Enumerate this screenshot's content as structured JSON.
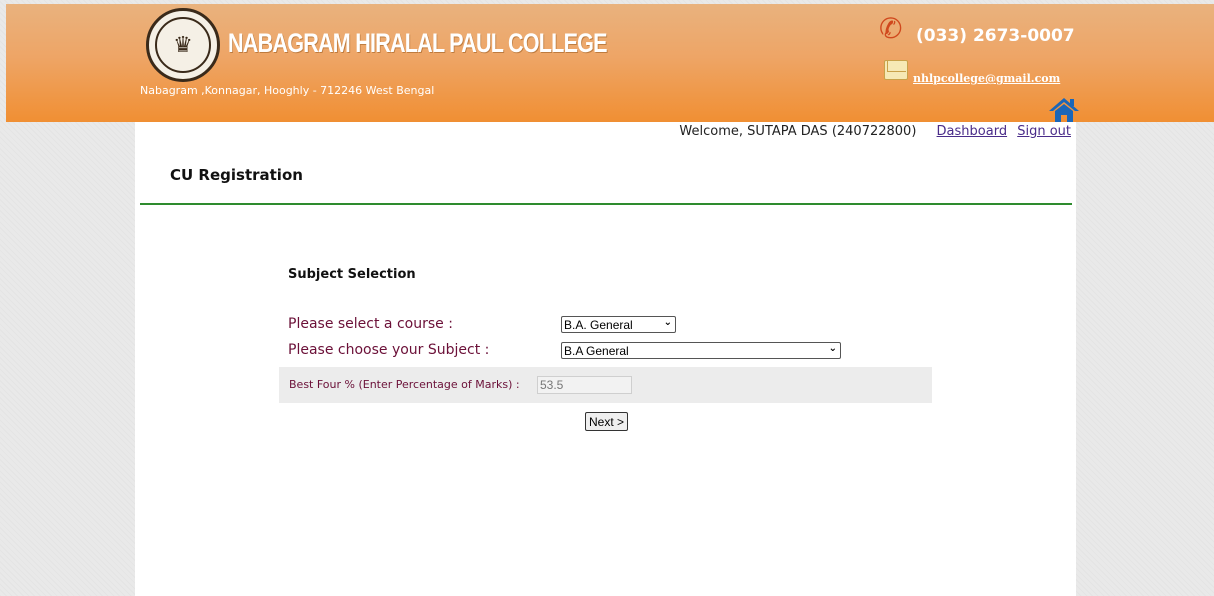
{
  "header": {
    "college_name": "NABAGRAM HIRALAL PAUL COLLEGE",
    "address": "Nabagram ,Konnagar, Hooghly - 712246 West Bengal",
    "phone": "(033) 2673-0007",
    "email": "nhlpcollege@gmail.com",
    "icons": {
      "phone": "phone-icon",
      "email": "envelope-icon",
      "home": "home-icon",
      "logo": "college-seal"
    }
  },
  "user_bar": {
    "welcome": "Welcome, SUTAPA DAS (240722800)",
    "dashboard_link": "Dashboard",
    "signout_link": "Sign out"
  },
  "page": {
    "title": "CU Registration",
    "section_title": "Subject Selection"
  },
  "form": {
    "course_label": "Please select a course :",
    "course_selected": "B.A. General",
    "subject_label": "Please choose your Subject :",
    "subject_selected": "B.A General",
    "marks_label": "Best Four % (Enter Percentage of Marks) :",
    "marks_value": "53.5",
    "next_button": "Next >"
  },
  "colors": {
    "header_gradient_top": "#e9b27e",
    "header_gradient_bottom": "#f08f33",
    "label_maroon": "#6b1038",
    "rule_green": "#2e8b2e",
    "link_purple": "#4a2c8a"
  }
}
